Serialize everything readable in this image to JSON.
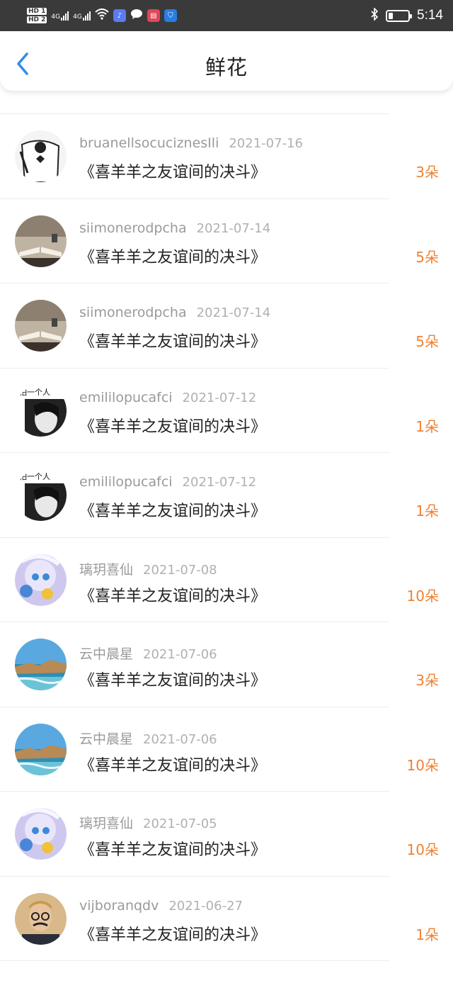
{
  "status_bar": {
    "hd1": "HD 1",
    "hd2": "HD 2",
    "net1": "4G",
    "net2": "4G",
    "time": "5:14",
    "icons": [
      "wifi-icon",
      "music-app-icon",
      "chat-icon",
      "book-app-icon",
      "shield-app-icon",
      "bluetooth-icon",
      "battery-icon"
    ]
  },
  "nav": {
    "title": "鲜花",
    "back_icon": "chevron-left-icon"
  },
  "colors": {
    "accent": "#f08030",
    "back": "#2e8de8"
  },
  "items": [
    {
      "user": "bruanellsocuciznesIli",
      "date": "2021-07-16",
      "title": "《喜羊羊之友谊间的决斗》",
      "count": "3朵",
      "avatar": "sketch"
    },
    {
      "user": "siimonerodpcha",
      "date": "2021-07-14",
      "title": "《喜羊羊之友谊间的决斗》",
      "count": "5朵",
      "avatar": "book"
    },
    {
      "user": "siimonerodpcha",
      "date": "2021-07-14",
      "title": "《喜羊羊之友谊间的决斗》",
      "count": "5朵",
      "avatar": "book"
    },
    {
      "user": "emililopucafci",
      "date": "2021-07-12",
      "title": "《喜羊羊之友谊间的决斗》",
      "count": "1朵",
      "avatar": "girl",
      "avatar_text": "怕一个人"
    },
    {
      "user": "emililopucafci",
      "date": "2021-07-12",
      "title": "《喜羊羊之友谊间的决斗》",
      "count": "1朵",
      "avatar": "girl",
      "avatar_text": "怕一个人"
    },
    {
      "user": "璃玥喜仙",
      "date": "2021-07-08",
      "title": "《喜羊羊之友谊间的决斗》",
      "count": "10朵",
      "avatar": "anime"
    },
    {
      "user": "云中晨星",
      "date": "2021-07-06",
      "title": "《喜羊羊之友谊间的决斗》",
      "count": "3朵",
      "avatar": "coast"
    },
    {
      "user": "云中晨星",
      "date": "2021-07-06",
      "title": "《喜羊羊之友谊间的决斗》",
      "count": "10朵",
      "avatar": "coast"
    },
    {
      "user": "璃玥喜仙",
      "date": "2021-07-05",
      "title": "《喜羊羊之友谊间的决斗》",
      "count": "10朵",
      "avatar": "anime"
    },
    {
      "user": "vijboranqdv",
      "date": "2021-06-27",
      "title": "《喜羊羊之友谊间的决斗》",
      "count": "1朵",
      "avatar": "man"
    }
  ]
}
